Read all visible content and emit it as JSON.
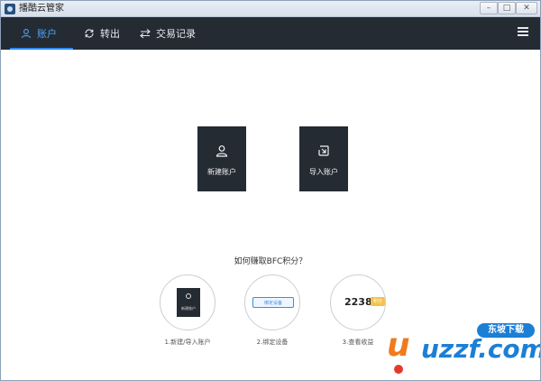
{
  "window": {
    "title": "播酷云管家",
    "controls": [
      "minimize",
      "maximize",
      "close"
    ]
  },
  "nav": {
    "tabs": [
      {
        "label": "账户",
        "icon": "user-icon",
        "active": true
      },
      {
        "label": "转出",
        "icon": "refresh-icon",
        "active": false
      },
      {
        "label": "交易记录",
        "icon": "swap-icon",
        "active": false
      }
    ],
    "menu_icon": "hamburger-icon"
  },
  "cards": {
    "new_account": {
      "label": "新建账户",
      "icon": "user-icon"
    },
    "import_account": {
      "label": "导入账户",
      "icon": "import-icon"
    }
  },
  "howto": {
    "title": "如何赚取BFC积分？",
    "steps": [
      {
        "label": "1.新建/导入账户",
        "inner_text": "新建账户"
      },
      {
        "label": "2.绑定设备",
        "inner_text": "绑定设备"
      },
      {
        "label": "3.查看收益",
        "inner_text": "2238",
        "tag": "积分"
      }
    ]
  },
  "watermark": {
    "brand": "uzzf.com",
    "badge": "东坡下载"
  },
  "colors": {
    "navbar": "#252b33",
    "accent": "#2f8cff",
    "card": "#252b33"
  }
}
